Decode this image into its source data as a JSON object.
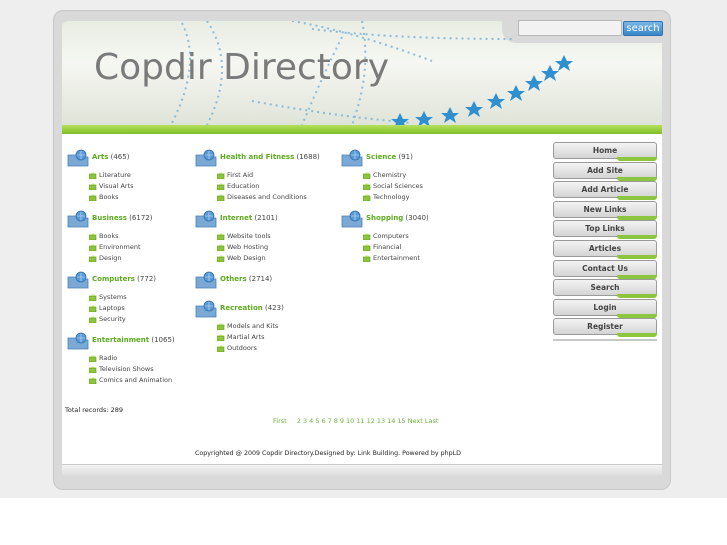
{
  "site": {
    "title": "Copdir Directory"
  },
  "search": {
    "value": "",
    "button_label": "search"
  },
  "categories": {
    "col1": [
      {
        "name": "Arts",
        "count": "(465)",
        "subs": [
          "Literature",
          "Visual Arts",
          "Books"
        ]
      },
      {
        "name": "Business",
        "count": "(6172)",
        "subs": [
          "Books",
          "Environment",
          "Design"
        ]
      },
      {
        "name": "Computers",
        "count": "(772)",
        "subs": [
          "Systems",
          "Laptops",
          "Security"
        ]
      },
      {
        "name": "Entertainment",
        "count": "(1065)",
        "subs": [
          "Radio",
          "Television Shows",
          "Comics and Animation"
        ]
      }
    ],
    "col2": [
      {
        "name": "Health and Fitness",
        "count": "(1688)",
        "subs": [
          "First Aid",
          "Education",
          "Diseases and Conditions"
        ]
      },
      {
        "name": "Internet",
        "count": "(2101)",
        "subs": [
          "Website tools",
          "Web Hosting",
          "Web Design"
        ]
      },
      {
        "name": "Others",
        "count": "(2714)",
        "subs": []
      },
      {
        "name": "Recreation",
        "count": "(423)",
        "subs": [
          "Models and Kits",
          "Martial Arts",
          "Outdoors"
        ]
      }
    ],
    "col3": [
      {
        "name": "Science",
        "count": "(91)",
        "subs": [
          "Chemistry",
          "Social Sciences",
          "Technology"
        ]
      },
      {
        "name": "Shopping",
        "count": "(3040)",
        "subs": [
          "Computers",
          "Financial",
          "Entertainment"
        ]
      }
    ]
  },
  "menu": [
    "Home",
    "Add Site",
    "Add Article",
    "New Links",
    "Top Links",
    "Articles",
    "Contact Us",
    "Search",
    "Login",
    "Register"
  ],
  "total_records": "Total records: 289",
  "pager": {
    "first": "First",
    "pages": [
      "2",
      "3",
      "4",
      "5",
      "6",
      "7",
      "8",
      "9",
      "10",
      "11",
      "12",
      "13",
      "14",
      "15"
    ],
    "next": "Next",
    "last": "Last"
  },
  "footer": {
    "copyright": "Copyrighted @ 2009 Copdir Directory.Designed by: Link Building. Powered by phpLD"
  },
  "colors": {
    "accent_green": "#5cab1e",
    "star_blue": "#3a9ad6",
    "search_blue": "#3a86c8"
  },
  "icons": {
    "category": "folder-globe-icon",
    "subcategory": "leaf-folder-icon"
  }
}
